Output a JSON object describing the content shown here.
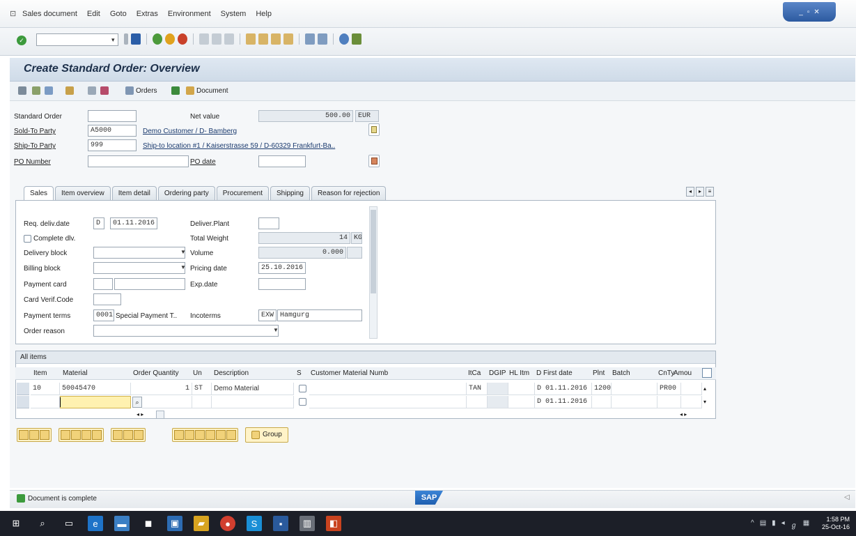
{
  "menubar": {
    "items": [
      "Sales document",
      "Edit",
      "Goto",
      "Extras",
      "Environment",
      "System",
      "Help"
    ]
  },
  "window_controls": [
    "_",
    "▫",
    "✕"
  ],
  "title": "Create Standard Order: Overview",
  "app_toolbar": {
    "orders_label": "Orders",
    "document_label": "Document"
  },
  "header": {
    "standard_order_label": "Standard Order",
    "standard_order_value": "",
    "net_value_label": "Net value",
    "net_value": "500.00",
    "currency": "EUR",
    "sold_to_label": "Sold-To Party",
    "sold_to_value": "A5000",
    "sold_to_desc": "Demo Customer / D- Bamberg",
    "ship_to_label": "Ship-To Party",
    "ship_to_value": "999",
    "ship_to_desc": "Ship-to location #1 / Kaiserstrasse 59 / D-60329 Frankfurt-Ba..",
    "po_number_label": "PO Number",
    "po_number_value": "",
    "po_date_label": "PO date",
    "po_date_value": ""
  },
  "tabs": [
    "Sales",
    "Item overview",
    "Item detail",
    "Ordering party",
    "Procurement",
    "Shipping",
    "Reason for rejection"
  ],
  "sales_tab": {
    "req_deliv_date_label": "Req. deliv.date",
    "req_deliv_date_type": "D",
    "req_deliv_date_value": "01.11.2016",
    "deliver_plant_label": "Deliver.Plant",
    "deliver_plant_value": "",
    "complete_dlv_label": "Complete dlv.",
    "total_weight_label": "Total Weight",
    "total_weight_value": "14",
    "total_weight_unit": "KG",
    "delivery_block_label": "Delivery block",
    "volume_label": "Volume",
    "volume_value": "0.000",
    "billing_block_label": "Billing block",
    "pricing_date_label": "Pricing date",
    "pricing_date_value": "25.10.2016",
    "payment_card_label": "Payment card",
    "exp_date_label": "Exp.date",
    "card_verif_label": "Card Verif.Code",
    "payment_terms_label": "Payment terms",
    "payment_terms_code": "0001",
    "payment_terms_desc": "Special Payment T..",
    "incoterms_label": "Incoterms",
    "incoterms_code": "EXW",
    "incoterms_place": "Hamgurg",
    "order_reason_label": "Order reason"
  },
  "items": {
    "section_title": "All items",
    "columns": [
      "Item",
      "Material",
      "Order Quantity",
      "Un",
      "Description",
      "S",
      "Customer Material Numb",
      "ItCa",
      "DGIP",
      "HL Itm",
      "D",
      "First date",
      "Plnt",
      "Batch",
      "CnTy",
      "Amou"
    ],
    "rows": [
      {
        "item": "10",
        "material": "50045470",
        "qty": "1",
        "un": "ST",
        "desc": "Demo Material",
        "itca": "TAN",
        "d": "D",
        "first_date": "01.11.2016",
        "plnt": "1200",
        "cnty": "PR00"
      },
      {
        "item": "",
        "material": "",
        "qty": "",
        "un": "",
        "desc": "",
        "itca": "",
        "d": "D",
        "first_date": "01.11.2016",
        "plnt": "",
        "cnty": ""
      }
    ]
  },
  "group_button": "Group",
  "status": {
    "message": "Document is complete",
    "logo": "SAP"
  },
  "clock": {
    "time": "1:58 PM",
    "date": "25-Oct-16"
  }
}
